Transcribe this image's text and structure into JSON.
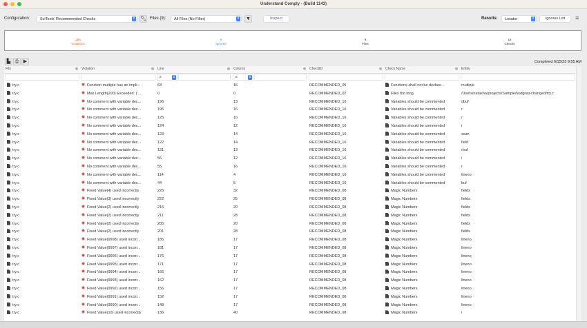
{
  "window": {
    "title": "Understand Comply - (Build 1143)"
  },
  "toolbar": {
    "config_label": "Configuration:",
    "config_value": "SciTools' Recommended Checks",
    "files_label": "Files (9):",
    "files_value": "All Files (No Filter)",
    "inspect_label": "Inspect",
    "results_label": "Results:",
    "results_value": "Locator",
    "ignores_label": "Ignores List"
  },
  "summary": {
    "violations_count": "266",
    "violations_label": "Violations",
    "ignored_count": "0",
    "ignored_label": "Ignored",
    "files_count": "9",
    "files_label": "Files",
    "checks_count": "18",
    "checks_label": "Checks"
  },
  "colors": {
    "violations": "#e0663a",
    "ignored": "#4a90d9",
    "accent": "#3b82f6"
  },
  "completed": "Completed 6/15/23 9:55 AM",
  "columns": [
    "File",
    "Violation",
    "Line",
    "Column",
    "CheckID",
    "Check Name",
    "Entity"
  ],
  "filters": {
    "line_op": "≥",
    "column_op": "≥"
  },
  "rows": [
    [
      "try.c",
      "Function multiple has an impli...",
      "63",
      "16",
      "RECOMMENDED_05",
      "Functions shall not be declare...",
      "multiple"
    ],
    [
      "try.c",
      "Max Length(200) Exceeded: ('...",
      "0",
      "0",
      "RECOMMENDED_02",
      "Files too long",
      "/Users/natasha/projects/Sample/fastgrep-changed/try.c"
    ],
    [
      "try.c",
      "No comment with variable dec...",
      "196",
      "13",
      "RECOMMENDED_16",
      "Variables should be commented",
      "dbuf"
    ],
    [
      "try.c",
      "No comment with variable dec...",
      "195",
      "16",
      "RECOMMENDED_16",
      "Variables should be commented",
      "r"
    ],
    [
      "try.c",
      "No comment with variable dec...",
      "125",
      "16",
      "RECOMMENDED_16",
      "Variables should be commented",
      "r"
    ],
    [
      "try.c",
      "No comment with variable dec...",
      "124",
      "12",
      "RECOMMENDED_16",
      "Variables should be commented",
      "i"
    ],
    [
      "try.c",
      "No comment with variable dec...",
      "123",
      "14",
      "RECOMMENDED_16",
      "Variables should be commented",
      "scan"
    ],
    [
      "try.c",
      "No comment with variable dec...",
      "122",
      "14",
      "RECOMMENDED_16",
      "Variables should be commented",
      "field"
    ],
    [
      "try.c",
      "No comment with variable dec...",
      "121",
      "13",
      "RECOMMENDED_16",
      "Variables should be commented",
      "rbuf"
    ],
    [
      "try.c",
      "No comment with variable dec...",
      "56",
      "12",
      "RECOMMENDED_16",
      "Variables should be commented",
      "i"
    ],
    [
      "try.c",
      "No comment with variable dec...",
      "55",
      "16",
      "RECOMMENDED_16",
      "Variables should be commented",
      "r"
    ],
    [
      "try.c",
      "No comment with variable dec...",
      "114",
      "4",
      "RECOMMENDED_16",
      "Variables should be commented",
      "lineno"
    ],
    [
      "try.c",
      "No comment with variable dec...",
      "44",
      "5",
      "RECOMMENDED_16",
      "Variables should be commented",
      "buf"
    ],
    [
      "try.c",
      "Fixed Value(4) used incorrectly",
      "226",
      "32",
      "RECOMMENDED_08",
      "Magic Numbers",
      "fields"
    ],
    [
      "try.c",
      "Fixed Value(3) used incorrectly",
      "222",
      "25",
      "RECOMMENDED_08",
      "Magic Numbers",
      "fields"
    ],
    [
      "try.c",
      "Fixed Value(2) used incorrectly",
      "216",
      "20",
      "RECOMMENDED_08",
      "Magic Numbers",
      "fields"
    ],
    [
      "try.c",
      "Fixed Value(2) used incorrectly",
      "211",
      "28",
      "RECOMMENDED_08",
      "Magic Numbers",
      "fields"
    ],
    [
      "try.c",
      "Fixed Value(2) used incorrectly",
      "205",
      "20",
      "RECOMMENDED_08",
      "Magic Numbers",
      "fields"
    ],
    [
      "try.c",
      "Fixed Value(2) used incorrectly",
      "201",
      "28",
      "RECOMMENDED_08",
      "Magic Numbers",
      "fields"
    ],
    [
      "try.c",
      "Fixed Value(9998) used incorr...",
      "185",
      "17",
      "RECOMMENDED_08",
      "Magic Numbers",
      "lineno"
    ],
    [
      "try.c",
      "Fixed Value(9997) used incorr...",
      "181",
      "17",
      "RECOMMENDED_08",
      "Magic Numbers",
      "lineno"
    ],
    [
      "try.c",
      "Fixed Value(9996) used incorr...",
      "176",
      "17",
      "RECOMMENDED_08",
      "Magic Numbers",
      "lineno"
    ],
    [
      "try.c",
      "Fixed Value(9995) used incorr...",
      "171",
      "17",
      "RECOMMENDED_08",
      "Magic Numbers",
      "lineno"
    ],
    [
      "try.c",
      "Fixed Value(9994) used incorr...",
      "166",
      "17",
      "RECOMMENDED_08",
      "Magic Numbers",
      "lineno"
    ],
    [
      "try.c",
      "Fixed Value(9993) used incorr...",
      "162",
      "17",
      "RECOMMENDED_08",
      "Magic Numbers",
      "lineno"
    ],
    [
      "try.c",
      "Fixed Value(9992) used incorr...",
      "156",
      "17",
      "RECOMMENDED_08",
      "Magic Numbers",
      "lineno"
    ],
    [
      "try.c",
      "Fixed Value(9991) used incorr...",
      "152",
      "17",
      "RECOMMENDED_08",
      "Magic Numbers",
      "lineno"
    ],
    [
      "try.c",
      "Fixed Value(9990) used incorr...",
      "148",
      "17",
      "RECOMMENDED_08",
      "Magic Numbers",
      "lineno"
    ],
    [
      "try.c",
      "Fixed Value(10) used incorrectly",
      "136",
      "40",
      "RECOMMENDED_08",
      "Magic Numbers",
      "i"
    ]
  ]
}
